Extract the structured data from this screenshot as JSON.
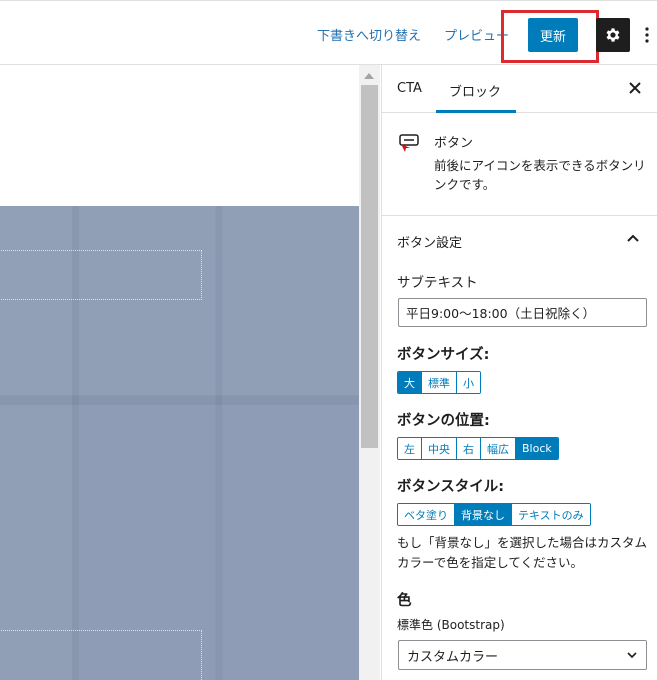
{
  "topbar": {
    "switch_to_draft": "下書きへ切り替え",
    "preview": "プレビュー",
    "update": "更新",
    "settings_icon": "gear-icon",
    "more_icon": "vertical-ellipsis-icon"
  },
  "sidebar": {
    "tabs": [
      {
        "label": "CTA",
        "active": false
      },
      {
        "label": "ブロック",
        "active": true
      }
    ],
    "close_icon": "close-icon",
    "block": {
      "icon": "button-block-icon",
      "title": "ボタン",
      "description": "前後にアイコンを表示できるボタンリンクです。"
    },
    "panel": {
      "title": "ボタン設定",
      "subtext_label": "サブテキスト",
      "subtext_value": "平日9:00～18:00（土日祝除く）",
      "size_label": "ボタンサイズ:",
      "size_options": [
        "大",
        "標準",
        "小"
      ],
      "size_selected": "大",
      "position_label": "ボタンの位置:",
      "position_options": [
        "左",
        "中央",
        "右",
        "幅広",
        "Block"
      ],
      "position_selected": "Block",
      "style_label": "ボタンスタイル:",
      "style_options": [
        "ベタ塗り",
        "背景なし",
        "テキストのみ"
      ],
      "style_selected": "背景なし",
      "style_help": "もし「背景なし」を選択した場合はカスタムカラーで色を指定してください。",
      "color_heading": "色",
      "standard_color_label": "標準色 (Bootstrap)",
      "standard_color_value": "カスタムカラー"
    }
  },
  "colors": {
    "accent": "#007cba",
    "highlight": "#dd2930",
    "cover": "#8a99b3"
  }
}
